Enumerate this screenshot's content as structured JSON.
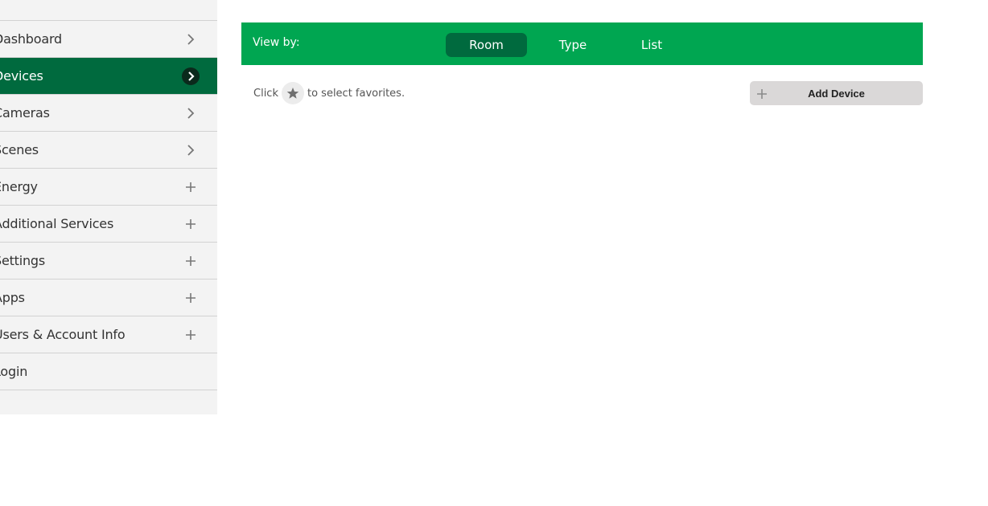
{
  "sidebar": {
    "items": [
      {
        "label": "Dashboard",
        "icon": "chevron-right-icon"
      },
      {
        "label": "Devices",
        "icon": "chevron-right-icon",
        "active": true
      },
      {
        "label": "Cameras",
        "icon": "chevron-right-icon"
      },
      {
        "label": "Scenes",
        "icon": "chevron-right-icon"
      },
      {
        "label": "Energy",
        "icon": "plus-icon"
      },
      {
        "label": "Additional Services",
        "icon": "plus-icon"
      },
      {
        "label": "Settings",
        "icon": "plus-icon"
      },
      {
        "label": "Apps",
        "icon": "plus-icon"
      },
      {
        "label": "Users & Account Info",
        "icon": "plus-icon"
      },
      {
        "label": "Login",
        "icon": ""
      }
    ]
  },
  "viewbar": {
    "label": "View by:",
    "tabs": [
      {
        "label": "Room",
        "selected": true
      },
      {
        "label": "Type",
        "selected": false
      },
      {
        "label": "List",
        "selected": false
      }
    ]
  },
  "favorites": {
    "prefix": "Click",
    "suffix": "to select favorites.",
    "icon": "star-icon"
  },
  "add_device": {
    "label": "Add Device",
    "icon": "plus-icon"
  },
  "colors": {
    "brand_green": "#00a651",
    "dark_green": "#006a3e",
    "sidebar_bg": "#f3f3f3",
    "button_bg": "#dad8d8"
  }
}
